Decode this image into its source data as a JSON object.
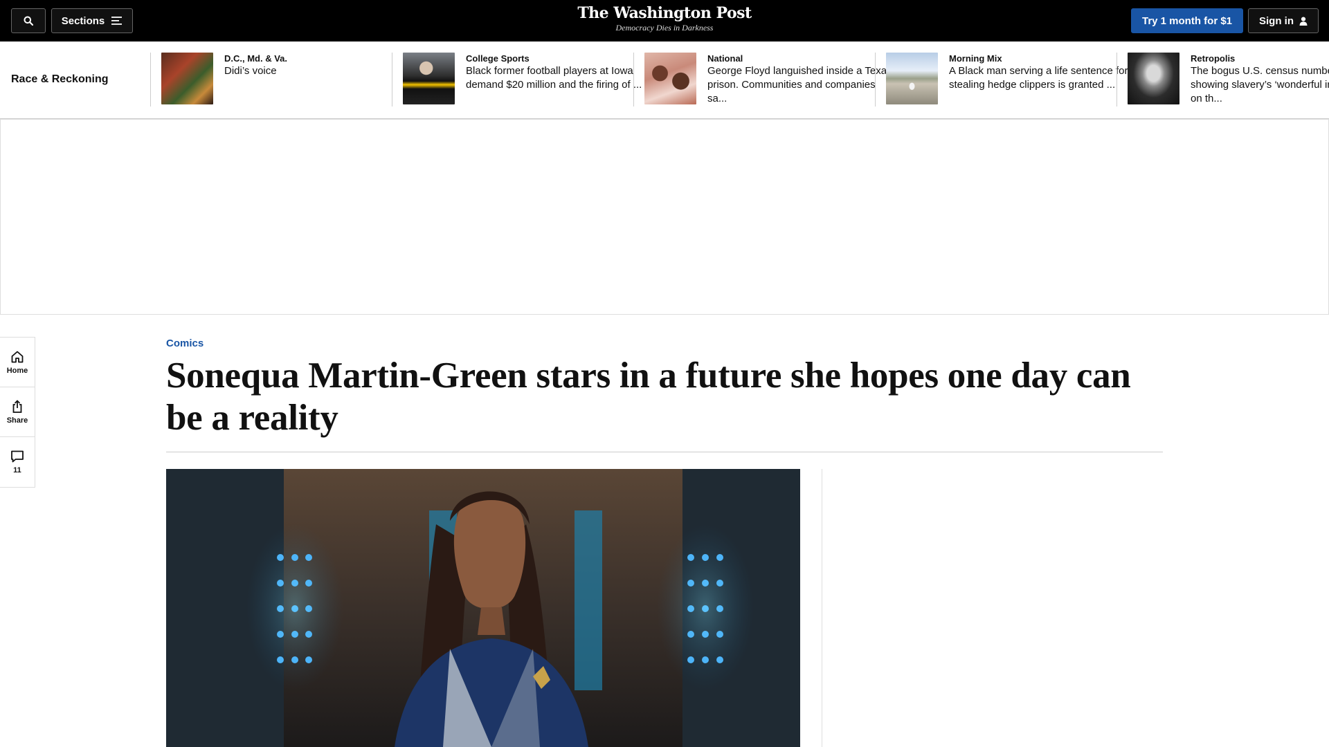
{
  "header": {
    "sections_label": "Sections",
    "logo_text": "The Washington Post",
    "tagline": "Democracy Dies in Darkness",
    "subscribe_label": "Try 1 month for $1",
    "signin_label": "Sign in"
  },
  "strip": {
    "label": "Race & Reckoning",
    "items": [
      {
        "kicker": "D.C., Md. & Va.",
        "headline": "Didi’s voice"
      },
      {
        "kicker": "College Sports",
        "headline": "Black former football players at Iowa demand $20 million and the firing of ..."
      },
      {
        "kicker": "National",
        "headline": "George Floyd languished inside a Texas prison. Communities and companies sa..."
      },
      {
        "kicker": "Morning Mix",
        "headline": "A Black man serving a life sentence for stealing hedge clippers is granted ..."
      },
      {
        "kicker": "Retropolis",
        "headline": "The bogus U.S. census numbers showing slavery’s ‘wonderful influence’ on th..."
      }
    ]
  },
  "rail": {
    "home_label": "Home",
    "share_label": "Share",
    "comments_count": "11"
  },
  "article": {
    "kicker": "Comics",
    "headline": "Sonequa Martin-Green stars in a future she hopes one day can be a reality"
  },
  "colors": {
    "topbar": "#000000",
    "accent_blue": "#1955a5",
    "divider": "#cccccc"
  },
  "icons": [
    "search-icon",
    "menu-icon",
    "user-icon",
    "home-icon",
    "share-icon",
    "comment-icon"
  ]
}
